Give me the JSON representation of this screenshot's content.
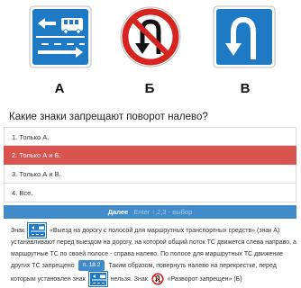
{
  "signs": {
    "a": {
      "label": "А",
      "icon": "bus-lane-sign-icon"
    },
    "b": {
      "label": "Б",
      "icon": "no-u-turn-sign-icon"
    },
    "c": {
      "label": "В",
      "icon": "u-turn-sign-icon"
    }
  },
  "question": "Какие знаки запрещают поворот налево?",
  "answers": [
    {
      "text": "1. Только А."
    },
    {
      "text": "2. Только А и Б.",
      "state": "wrong"
    },
    {
      "text": "3. Только А и В."
    },
    {
      "text": "4. Все."
    }
  ],
  "next": {
    "label": "Далее",
    "hint": "Enter ↑,2,3 - выбор"
  },
  "explanation": {
    "p1": "Знак",
    "p2": "«Выезд на дорогу с полосой для маршрутных транспортных средств» (знак А) устанавливают перед выездом на дорогу, на которой общий поток ТС движется слева направо, а маршрутные ТС по своей полосе - справа налево. По полосе для маршрутных ТС движение других ТС запрещено",
    "pill": "п. 18.2",
    "p3": "Таким образом, повернуть налево на перекрестке, перед которым установлен знак",
    "p4": "нельзя. Знак",
    "p5": "«Разворот запрещен» (Б)"
  },
  "colors": {
    "sign_blue": "#1e7ac4",
    "sign_red": "#d5251e",
    "wrong_answer": "#d9534f",
    "next_bar": "#428bca"
  }
}
